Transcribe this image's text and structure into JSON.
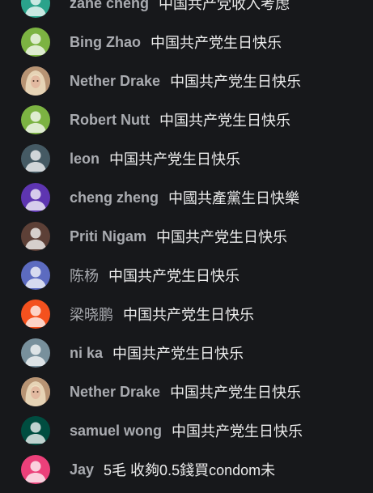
{
  "messages": [
    {
      "author": "zane cheng",
      "text": "中国共产党收入考虑",
      "avatar_color": "#2aa38b",
      "avatar_icon": "person-icon"
    },
    {
      "author": "Bing Zhao",
      "text": "中国共产党生日快乐",
      "avatar_color": "#7cb342",
      "avatar_icon": "person-icon"
    },
    {
      "author": "Nether Drake",
      "text": "中国共产党生日快乐",
      "avatar_color": "#c9a98a",
      "avatar_icon": "photo-avatar-icon"
    },
    {
      "author": "Robert Nutt",
      "text": "中国共产党生日快乐",
      "avatar_color": "#7cb342",
      "avatar_icon": "person-icon"
    },
    {
      "author": "leon",
      "text": "中国共产党生日快乐",
      "avatar_color": "#455a64",
      "avatar_icon": "person-icon"
    },
    {
      "author": "cheng zheng",
      "text": "中國共產黨生日快樂",
      "avatar_color": "#5e35b1",
      "avatar_icon": "person-icon"
    },
    {
      "author": "Priti Nigam",
      "text": "中国共产党生日快乐",
      "avatar_color": "#5d4037",
      "avatar_icon": "person-icon"
    },
    {
      "author": "陈杨",
      "text": "中国共产党生日快乐",
      "avatar_color": "#5c6bc0",
      "avatar_icon": "person-icon"
    },
    {
      "author": "梁晓鹏",
      "text": "中国共产党生日快乐",
      "avatar_color": "#f4511e",
      "avatar_icon": "person-icon"
    },
    {
      "author": "ni ka",
      "text": "中国共产党生日快乐",
      "avatar_color": "#78909c",
      "avatar_icon": "person-icon"
    },
    {
      "author": "Nether Drake",
      "text": "中国共产党生日快乐",
      "avatar_color": "#c9a98a",
      "avatar_icon": "photo-avatar-icon"
    },
    {
      "author": "samuel wong",
      "text": "中国共产党生日快乐",
      "avatar_color": "#004d40",
      "avatar_icon": "person-icon"
    },
    {
      "author": "Jay",
      "text": "5毛 收夠0.5錢買condom未",
      "avatar_color": "#ec407a",
      "avatar_icon": "person-icon"
    }
  ]
}
